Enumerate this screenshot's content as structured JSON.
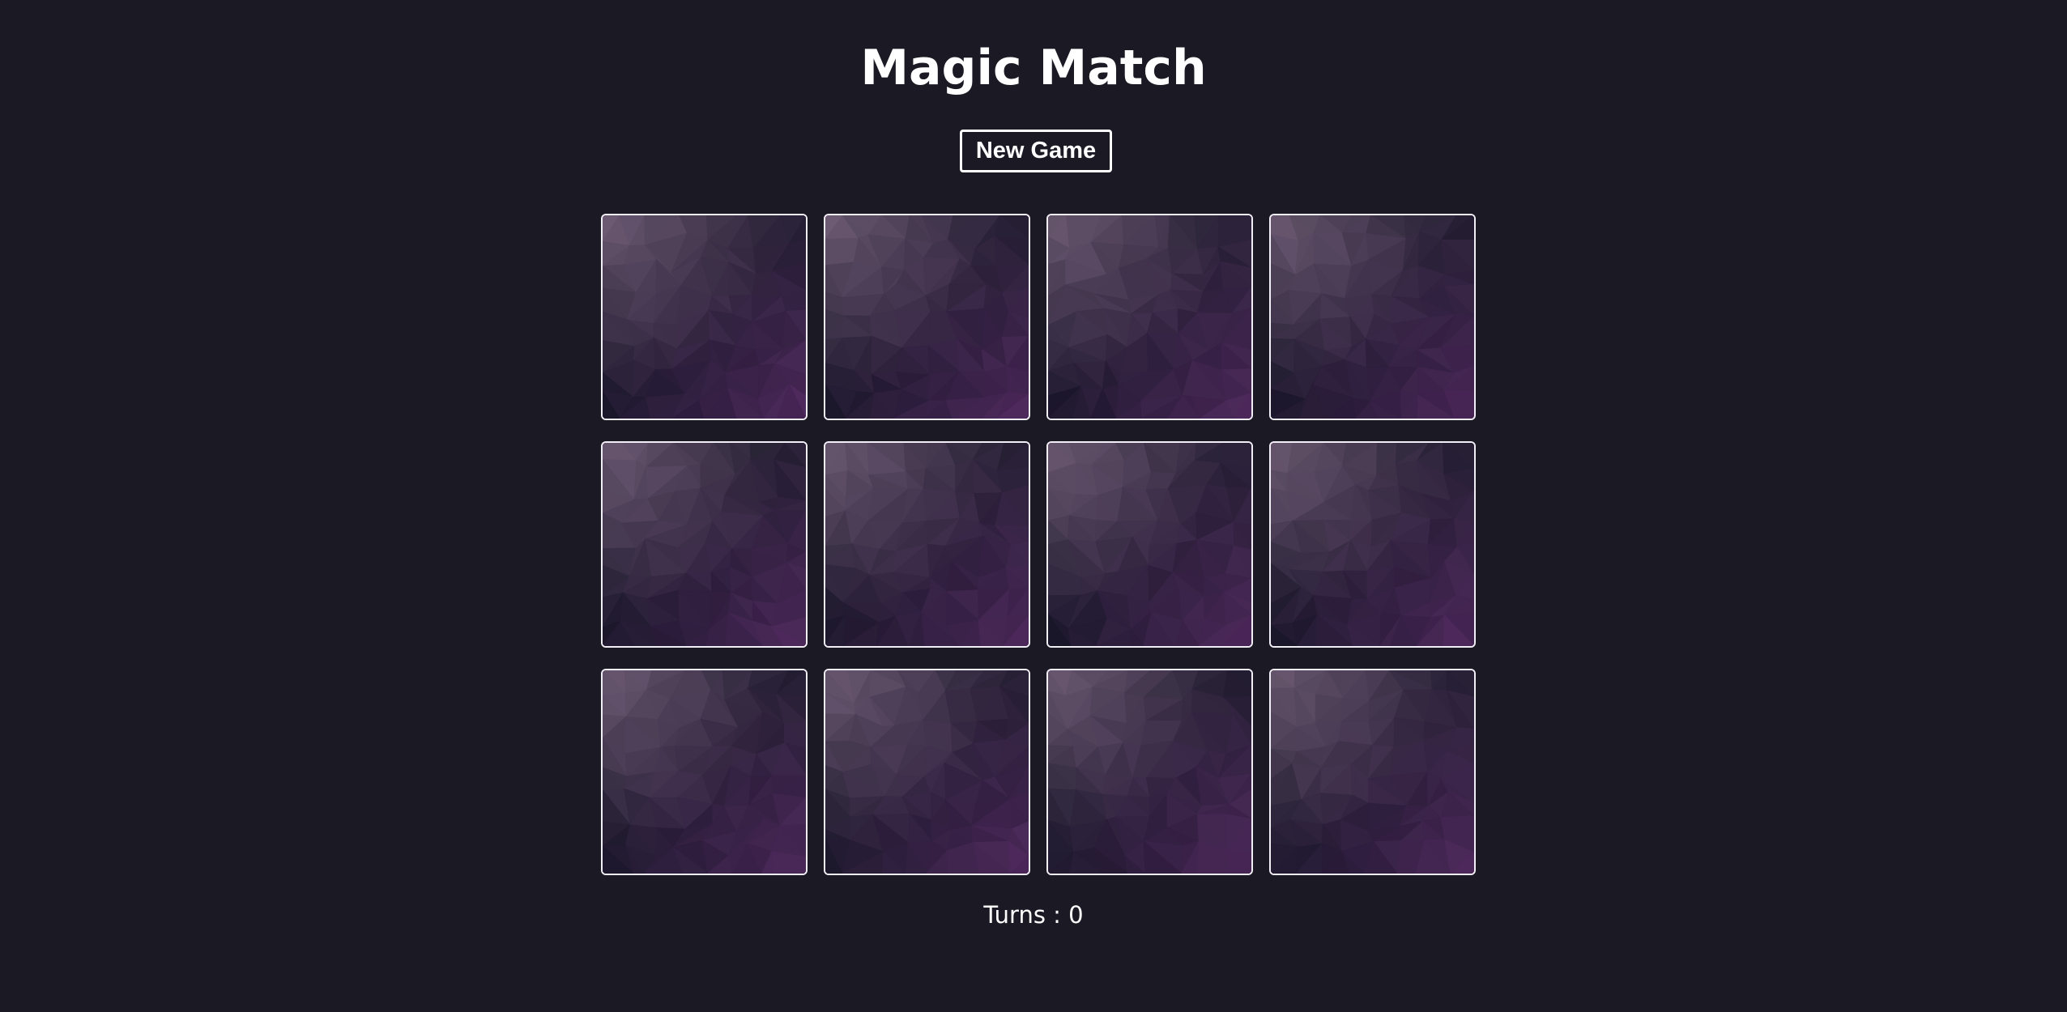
{
  "game": {
    "title": "Magic Match",
    "new_game_label": "New Game",
    "turns_label": "Turns : ",
    "turns": "0"
  },
  "colors": {
    "background": "#1b1923",
    "card_border": "#f2eef5",
    "card_back_light": "#6b5a6e",
    "card_back_mid": "#3a2d4b",
    "card_back_dark": "#1f1a2c",
    "card_back_accent": "#4a2a5c"
  },
  "cards": [
    {
      "state": "face-down",
      "icon": "card-back-pattern-icon"
    },
    {
      "state": "face-down",
      "icon": "card-back-pattern-icon"
    },
    {
      "state": "face-down",
      "icon": "card-back-pattern-icon"
    },
    {
      "state": "face-down",
      "icon": "card-back-pattern-icon"
    },
    {
      "state": "face-down",
      "icon": "card-back-pattern-icon"
    },
    {
      "state": "face-down",
      "icon": "card-back-pattern-icon"
    },
    {
      "state": "face-down",
      "icon": "card-back-pattern-icon"
    },
    {
      "state": "face-down",
      "icon": "card-back-pattern-icon"
    },
    {
      "state": "face-down",
      "icon": "card-back-pattern-icon"
    },
    {
      "state": "face-down",
      "icon": "card-back-pattern-icon"
    },
    {
      "state": "face-down",
      "icon": "card-back-pattern-icon"
    },
    {
      "state": "face-down",
      "icon": "card-back-pattern-icon"
    }
  ]
}
